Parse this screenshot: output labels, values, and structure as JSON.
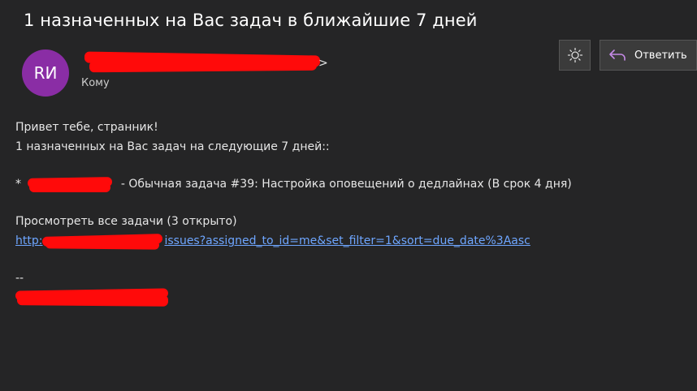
{
  "email": {
    "subject": "1 назначенных на Вас задач в ближайшие 7 дней",
    "sender": {
      "initials": "RИ",
      "avatar_color": "#8a2da5",
      "address_suffix": ">"
    },
    "to_label": "Кому"
  },
  "toolbar": {
    "theme_icon": "sun-icon",
    "reply_icon": "reply-arrow-icon",
    "reply_label": "Ответить"
  },
  "body": {
    "greeting": "Привет тебе, странник!",
    "summary": "1 назначенных на Вас задач на следующие 7 дней::",
    "task_bullet": "*",
    "task_text": "- Обычная задача #39: Настройка оповещений о дедлайнах (В срок 4 дня)",
    "view_all": "Просмотреть все задачи (3 открыто)",
    "link_prefix": "http:",
    "link_suffix": "issues?assigned_to_id=me&set_filter=1&sort=due_date%3Aasc",
    "signature_separator": "--"
  },
  "colors": {
    "background": "#252526",
    "link": "#6ea6ff",
    "redaction": "#ff0a0a"
  }
}
